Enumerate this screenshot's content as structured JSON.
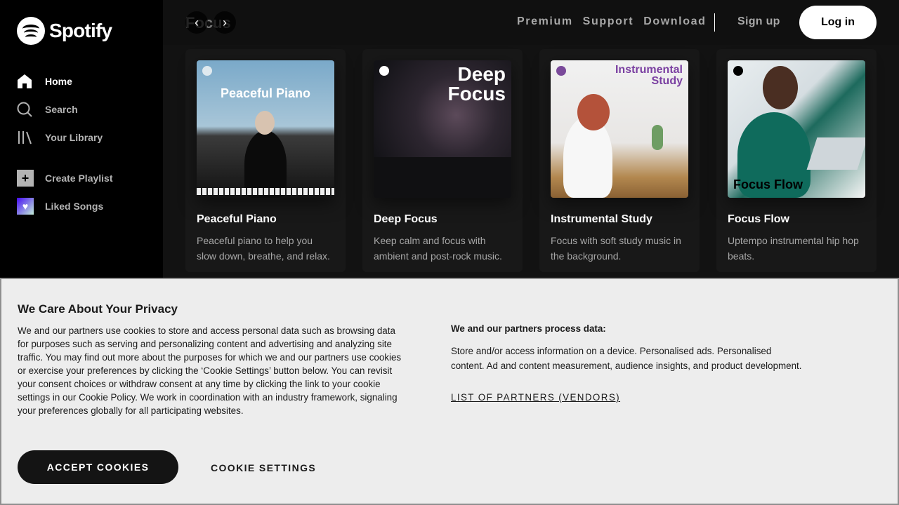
{
  "brand": {
    "name": "Spotify"
  },
  "sidebar": {
    "items": [
      {
        "label": "Home",
        "icon": "home-icon"
      },
      {
        "label": "Search",
        "icon": "search-icon"
      },
      {
        "label": "Your Library",
        "icon": "library-icon"
      }
    ],
    "actions": [
      {
        "label": "Create Playlist",
        "icon": "plus-icon"
      },
      {
        "label": "Liked Songs",
        "icon": "heart-icon"
      }
    ]
  },
  "header": {
    "title": "Focus",
    "back_glyph": "‹",
    "forward_glyph": "›",
    "links": [
      "Premium",
      "Support",
      "Download"
    ],
    "signup": "Sign up",
    "login": "Log in"
  },
  "cards": [
    {
      "title": "Peaceful Piano",
      "description": "Peaceful piano to help you slow down, breathe, and relax.",
      "cover_text": "Peaceful Piano"
    },
    {
      "title": "Deep Focus",
      "description": "Keep calm and focus with ambient and post-rock music.",
      "cover_text": "Deep Focus"
    },
    {
      "title": "Instrumental Study",
      "description": "Focus with soft study music in the background.",
      "cover_text": "Instrumental Study"
    },
    {
      "title": "Focus Flow",
      "description": "Uptempo instrumental hip hop beats.",
      "cover_text": "Focus Flow"
    }
  ],
  "cookie": {
    "title": "We Care About Your Privacy",
    "body": "We and our partners use cookies to store and access personal data such as browsing data for purposes such as serving and personalizing content and advertising and analyzing site traffic. You may find out more about the purposes for which we and our partners use cookies or exercise your preferences by clicking the ‘Cookie Settings’ button below. You can revisit your consent choices or withdraw consent at any time by clicking the link to your cookie settings in our Cookie Policy. We work in coordination with an industry framework, signaling your preferences globally for all participating websites.",
    "right_heading": "We and our partners process data:",
    "right_body": "Store and/or access information on a device. Personalised ads. Personalised content. Ad and content measurement, audience insights, and product development.",
    "partners_link": "LIST OF PARTNERS (VENDORS)",
    "accept": "ACCEPT COOKIES",
    "settings": "COOKIE SETTINGS"
  },
  "colors": {
    "sidebar_bg": "#000000",
    "main_bg": "#121212",
    "card_bg": "#181818",
    "cookie_bg": "#ededed",
    "instrumental_title": "#7a3fa1"
  }
}
